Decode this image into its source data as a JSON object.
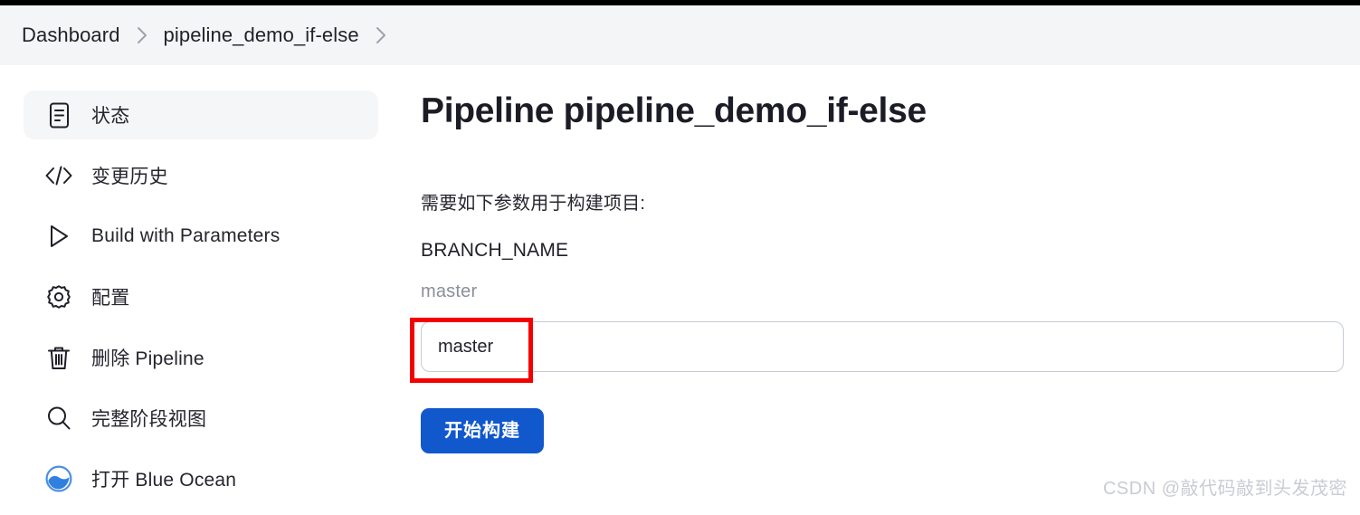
{
  "window": {
    "app": "Jenkins",
    "top_strip_color": "#000000"
  },
  "breadcrumb": {
    "items": [
      {
        "label": "Dashboard",
        "icon": ""
      },
      {
        "label": "pipeline_demo_if-else",
        "icon": ""
      }
    ],
    "separator_icon": "chevron-right-icon",
    "background": "#f4f5f7"
  },
  "sidebar": {
    "items": [
      {
        "label": "状态",
        "icon": "document-status-icon",
        "active": true
      },
      {
        "label": "变更历史",
        "icon": "code-brackets-icon",
        "active": false
      },
      {
        "label": "Build with Parameters",
        "icon": "play-triangle-icon",
        "active": false
      },
      {
        "label": "配置",
        "icon": "gear-icon",
        "active": false
      },
      {
        "label": "删除 Pipeline",
        "icon": "trash-icon",
        "active": false
      },
      {
        "label": "完整阶段视图",
        "icon": "magnifier-icon",
        "active": false
      },
      {
        "label": "打开 Blue Ocean",
        "icon": "blue-ocean-icon",
        "active": false
      }
    ],
    "active_background": "#f5f6f7"
  },
  "main": {
    "title": "Pipeline pipeline_demo_if-else",
    "params_intro": "需要如下参数用于构建项目:",
    "parameter": {
      "name": "BRANCH_NAME",
      "description": "master",
      "value": "master",
      "placeholder": ""
    },
    "build_button": {
      "label": "开始构建",
      "color": "#1158cd"
    }
  },
  "annotation": {
    "type": "red-rectangle-highlight",
    "color": "#f40000",
    "targets": "branch-name-input"
  },
  "watermark": {
    "text": "CSDN @敲代码敲到头发茂密",
    "color": "#c9ccd2"
  }
}
